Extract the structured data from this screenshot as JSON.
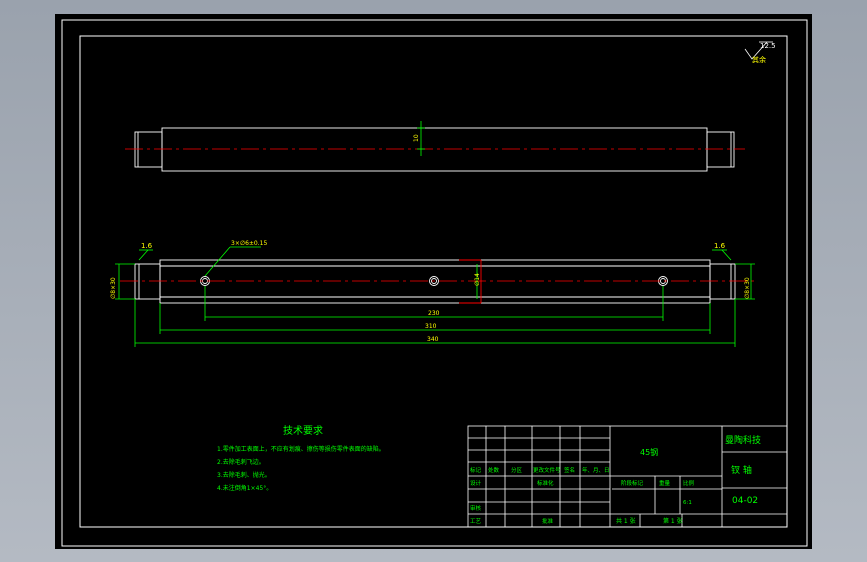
{
  "drawing": {
    "roughness_symbol": "12.5",
    "roughness_note": "其余",
    "top_view_dim": "10",
    "hole_callout": "3×∅6±0.15",
    "chamfer_left": "1.6",
    "chamfer_right": "1.6",
    "dia_left": "∅8×30",
    "dia_right": "∅8×30",
    "center_dim": "∅14",
    "dim_230": "230",
    "dim_310": "310",
    "dim_340": "340"
  },
  "tech_requirements": {
    "title": "技术要求",
    "items": [
      "1.零件加工表面上，不应有划痕、擦伤等损伤零件表面的缺陷。",
      "2.去除毛刺飞边。",
      "3.去除毛刺、抛光。",
      "4.未注倒角1×45°。"
    ]
  },
  "title_block": {
    "company": "曼陶科技",
    "part_name": "钗  轴",
    "drawing_no": "04-02",
    "material": "45钢",
    "header_row": [
      "标记",
      "处数",
      "分区",
      "更改文件号",
      "签名",
      "年、月、日"
    ],
    "design": "设计",
    "standardize": "标准化",
    "stage_mark": "阶段标记",
    "weight": "重量",
    "scale_label": "比例",
    "scale": "6:1",
    "review": "审核",
    "process": "工艺",
    "approve": "批准",
    "sheets_total": "共 1 张",
    "sheet_no": "第 1 张"
  },
  "colors": {
    "outline": "#ffffff",
    "dimension": "#00ff00",
    "centerline": "#ff0000",
    "text_green": "#00ff00"
  }
}
